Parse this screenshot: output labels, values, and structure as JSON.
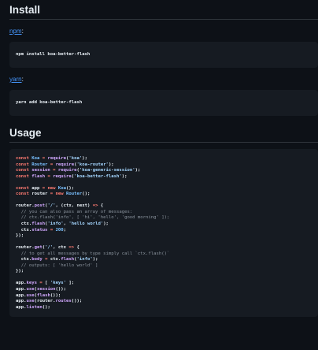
{
  "install": {
    "heading": "Install",
    "npm_label": "npm",
    "npm_command": "npm install koa-better-flash",
    "yarn_label": "yarn",
    "yarn_command": "yarn add koa-better-flash"
  },
  "usage": {
    "heading": "Usage",
    "code_lines": [
      "const Koa = require('koa');",
      "const Router = require('koa-router');",
      "const session = require('koa-generic-session');",
      "const flash = require('koa-better-flash');",
      "",
      "const app = new Koa();",
      "const router = new Router();",
      "",
      "router.post('/', (ctx, next) => {",
      "  // you can also pass an array of messages:",
      "  // ctx.flash('info', [ 'hi', 'hello', 'good morning' ]);",
      "  ctx.flash('info', 'hello world');",
      "  ctx.status = 200;",
      "});",
      "",
      "router.get('/', ctx => {",
      "  // to get all messages by type simply call `ctx.flash()`",
      "  ctx.body = ctx.flash('info');",
      "  // outputs: [ 'hello world' ]",
      "});",
      "",
      "app.keys = [ 'keys' ];",
      "app.use(session());",
      "app.use(flash());",
      "app.use(router.routes());",
      "app.listen();"
    ]
  }
}
